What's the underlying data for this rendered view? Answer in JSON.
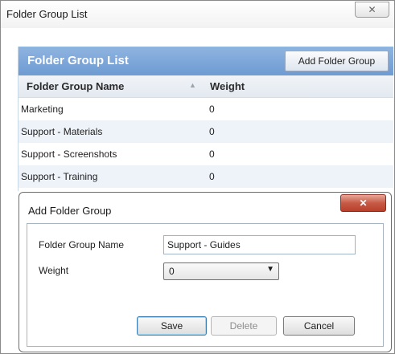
{
  "window": {
    "title": "Folder Group List",
    "close_glyph": "✕"
  },
  "panel": {
    "title": "Folder Group List",
    "add_button": "Add Folder Group",
    "columns": {
      "name": "Folder Group Name",
      "sort_glyph": "▲",
      "weight": "Weight"
    },
    "rows": [
      {
        "name": "Marketing",
        "weight": "0"
      },
      {
        "name": "Support - Materials",
        "weight": "0"
      },
      {
        "name": "Support - Screenshots",
        "weight": "0"
      },
      {
        "name": "Support - Training",
        "weight": "0"
      }
    ]
  },
  "dialog": {
    "title": "Add Folder Group",
    "close_glyph": "✕",
    "fields": {
      "name_label": "Folder Group Name",
      "name_value": "Support - Guides",
      "weight_label": "Weight",
      "weight_value": "0",
      "dropdown_glyph": "▼"
    },
    "buttons": {
      "save": "Save",
      "delete": "Delete",
      "cancel": "Cancel"
    }
  },
  "colors": {
    "panel_header": "#7aa4d9",
    "dialog_close": "#c65a45",
    "alt_row": "#eef3fa"
  },
  "icons": [
    "close-icon",
    "sort-ascending-icon",
    "dropdown-arrow-icon"
  ]
}
